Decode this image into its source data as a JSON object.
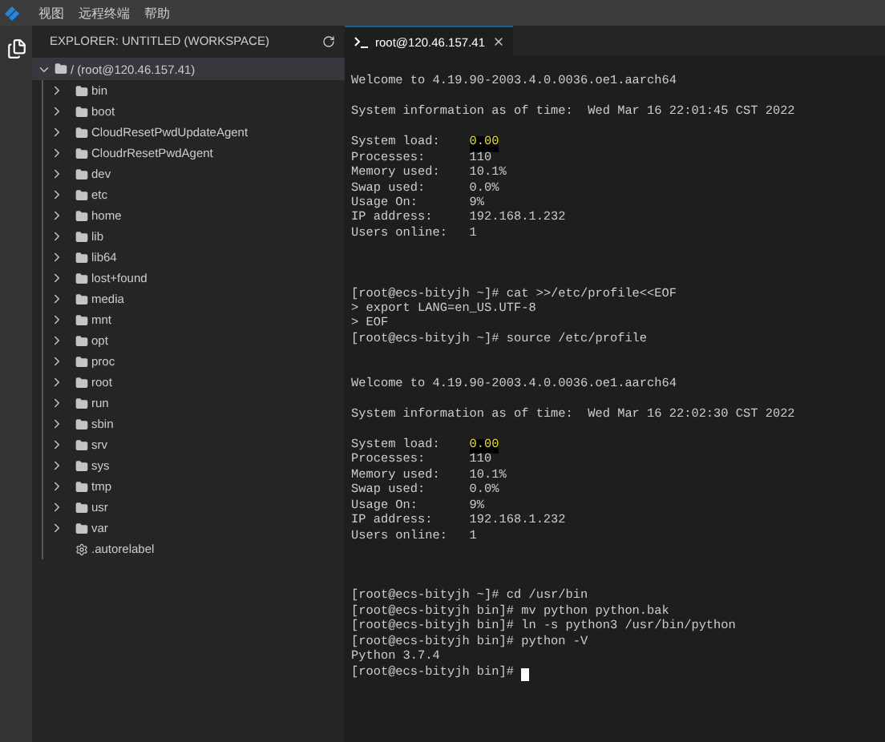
{
  "menu_bar": {
    "items": [
      "视图",
      "远程终端",
      "帮助"
    ]
  },
  "sidebar": {
    "title": "EXPLORER: UNTITLED (WORKSPACE)",
    "tree": {
      "label": "/ (root@120.46.157.41)",
      "expanded": true,
      "children": [
        {
          "label": "bin",
          "kind": "folder",
          "expanded": false
        },
        {
          "label": "boot",
          "kind": "folder",
          "expanded": false
        },
        {
          "label": "CloudResetPwdUpdateAgent",
          "kind": "folder",
          "expanded": false
        },
        {
          "label": "CloudrResetPwdAgent",
          "kind": "folder",
          "expanded": false
        },
        {
          "label": "dev",
          "kind": "folder",
          "expanded": false
        },
        {
          "label": "etc",
          "kind": "folder",
          "expanded": false
        },
        {
          "label": "home",
          "kind": "folder",
          "expanded": false
        },
        {
          "label": "lib",
          "kind": "folder",
          "expanded": false
        },
        {
          "label": "lib64",
          "kind": "folder",
          "expanded": false
        },
        {
          "label": "lost+found",
          "kind": "folder",
          "expanded": false
        },
        {
          "label": "media",
          "kind": "folder",
          "expanded": false
        },
        {
          "label": "mnt",
          "kind": "folder",
          "expanded": false
        },
        {
          "label": "opt",
          "kind": "folder",
          "expanded": false
        },
        {
          "label": "proc",
          "kind": "folder",
          "expanded": false
        },
        {
          "label": "root",
          "kind": "folder",
          "expanded": false
        },
        {
          "label": "run",
          "kind": "folder",
          "expanded": false
        },
        {
          "label": "sbin",
          "kind": "folder",
          "expanded": false
        },
        {
          "label": "srv",
          "kind": "folder",
          "expanded": false
        },
        {
          "label": "sys",
          "kind": "folder",
          "expanded": false
        },
        {
          "label": "tmp",
          "kind": "folder",
          "expanded": false
        },
        {
          "label": "usr",
          "kind": "folder",
          "expanded": false
        },
        {
          "label": "var",
          "kind": "folder",
          "expanded": false
        },
        {
          "label": ".autorelabel",
          "kind": "file"
        }
      ]
    }
  },
  "tabs": [
    {
      "label": "root@120.46.157.41",
      "selected": true
    }
  ],
  "terminal": {
    "lines": [
      {
        "kind": "blank"
      },
      {
        "kind": "text",
        "text": "Welcome to 4.19.90-2003.4.0.0036.oe1.aarch64"
      },
      {
        "kind": "blank"
      },
      {
        "kind": "text",
        "text": "System information as of time:  Wed Mar 16 22:01:45 CST 2022"
      },
      {
        "kind": "blank"
      },
      {
        "kind": "info",
        "label": "System load:",
        "value": "0.00",
        "highlighted": true
      },
      {
        "kind": "info",
        "label": "Processes:",
        "value": "110",
        "highlighted": false
      },
      {
        "kind": "info",
        "label": "Memory used:",
        "value": "10.1%",
        "highlighted": false
      },
      {
        "kind": "info",
        "label": "Swap used:",
        "value": "0.0%",
        "highlighted": false
      },
      {
        "kind": "info",
        "label": "Usage On:",
        "value": "9%",
        "highlighted": false
      },
      {
        "kind": "info",
        "label": "IP address:",
        "value": "192.168.1.232",
        "highlighted": false
      },
      {
        "kind": "info",
        "label": "Users online:",
        "value": "1",
        "highlighted": false
      },
      {
        "kind": "blank"
      },
      {
        "kind": "blank"
      },
      {
        "kind": "blank"
      },
      {
        "kind": "text",
        "text": "[root@ecs-bityjh ~]# cat >>/etc/profile<<EOF"
      },
      {
        "kind": "text",
        "text": "> export LANG=en_US.UTF-8"
      },
      {
        "kind": "text",
        "text": "> EOF"
      },
      {
        "kind": "text",
        "text": "[root@ecs-bityjh ~]# source /etc/profile"
      },
      {
        "kind": "blank"
      },
      {
        "kind": "blank"
      },
      {
        "kind": "text",
        "text": "Welcome to 4.19.90-2003.4.0.0036.oe1.aarch64"
      },
      {
        "kind": "blank"
      },
      {
        "kind": "text",
        "text": "System information as of time:  Wed Mar 16 22:02:30 CST 2022"
      },
      {
        "kind": "blank"
      },
      {
        "kind": "info",
        "label": "System load:",
        "value": "0.00",
        "highlighted": true
      },
      {
        "kind": "info",
        "label": "Processes:",
        "value": "110",
        "highlighted": false
      },
      {
        "kind": "info",
        "label": "Memory used:",
        "value": "10.1%",
        "highlighted": false
      },
      {
        "kind": "info",
        "label": "Swap used:",
        "value": "0.0%",
        "highlighted": false
      },
      {
        "kind": "info",
        "label": "Usage On:",
        "value": "9%",
        "highlighted": false
      },
      {
        "kind": "info",
        "label": "IP address:",
        "value": "192.168.1.232",
        "highlighted": false
      },
      {
        "kind": "info",
        "label": "Users online:",
        "value": "1",
        "highlighted": false
      },
      {
        "kind": "blank"
      },
      {
        "kind": "blank"
      },
      {
        "kind": "blank"
      },
      {
        "kind": "text",
        "text": "[root@ecs-bityjh ~]# cd /usr/bin"
      },
      {
        "kind": "text",
        "text": "[root@ecs-bityjh bin]# mv python python.bak"
      },
      {
        "kind": "text",
        "text": "[root@ecs-bityjh bin]# ln -s python3 /usr/bin/python"
      },
      {
        "kind": "text",
        "text": "[root@ecs-bityjh bin]# python -V"
      },
      {
        "kind": "text",
        "text": "Python 3.7.4"
      },
      {
        "kind": "prompt",
        "text": "[root@ecs-bityjh bin]# ",
        "cursor": true
      }
    ]
  }
}
